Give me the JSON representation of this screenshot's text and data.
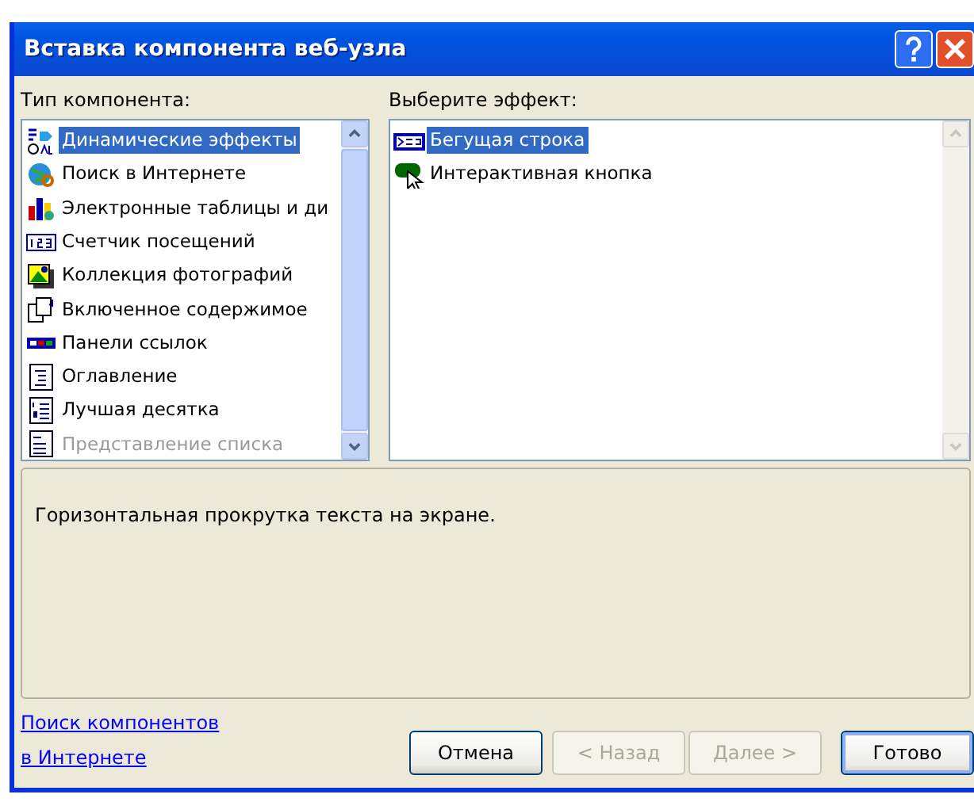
{
  "window": {
    "title": "Вставка компонента веб-узла"
  },
  "component_types": {
    "label": "Тип компонента:",
    "items": [
      {
        "label": "Динамические эффекты",
        "kind": "effects",
        "selected": true,
        "disabled": false
      },
      {
        "label": "Поиск в Интернете",
        "kind": "globe",
        "selected": false,
        "disabled": false
      },
      {
        "label": "Электронные таблицы и ди",
        "kind": "chart",
        "selected": false,
        "disabled": false
      },
      {
        "label": "Счетчик посещений",
        "kind": "counter",
        "selected": false,
        "disabled": false
      },
      {
        "label": "Коллекция фотографий",
        "kind": "photos",
        "selected": false,
        "disabled": false
      },
      {
        "label": "Включенное содержимое",
        "kind": "pages",
        "selected": false,
        "disabled": false
      },
      {
        "label": "Панели ссылок",
        "kind": "bar",
        "selected": false,
        "disabled": false
      },
      {
        "label": "Оглавление",
        "kind": "toc",
        "selected": false,
        "disabled": false
      },
      {
        "label": "Лучшая десятка",
        "kind": "numbered",
        "selected": false,
        "disabled": false
      },
      {
        "label": "Представление списка",
        "kind": "listview",
        "selected": false,
        "disabled": true
      }
    ]
  },
  "effects": {
    "label": "Выберите эффект:",
    "items": [
      {
        "label": "Бегущая строка",
        "kind": "marquee",
        "selected": true
      },
      {
        "label": "Интерактивная кнопка",
        "kind": "button",
        "selected": false
      }
    ]
  },
  "description": "Горизонтальная прокрутка текста на экране.",
  "link_lines": [
    "Поиск компонентов",
    "в Интернете"
  ],
  "buttons": [
    {
      "label": "Отмена",
      "disabled": false,
      "default": false
    },
    {
      "label": "< Назад",
      "disabled": true,
      "default": false
    },
    {
      "label": "Далее >",
      "disabled": true,
      "default": false
    },
    {
      "label": "Готово",
      "disabled": false,
      "default": true
    }
  ]
}
